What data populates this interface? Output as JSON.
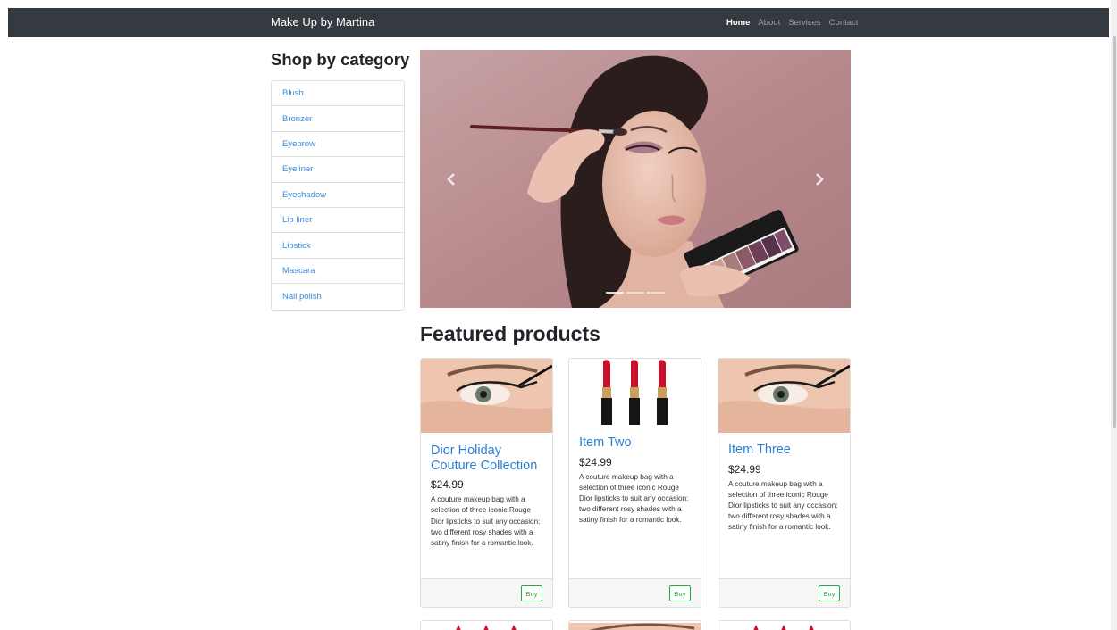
{
  "navbar": {
    "brand": "Make Up by Martina",
    "links": [
      "Home",
      "About",
      "Services",
      "Contact"
    ],
    "active_link": "Home"
  },
  "sidebar": {
    "title": "Shop by category",
    "categories": [
      "Blush",
      "Bronzer",
      "Eyebrow",
      "Eyeliner",
      "Eyeshadow",
      "Lip liner",
      "Lipstick",
      "Mascara",
      "Nail polish"
    ]
  },
  "carousel": {
    "prev_glyph": "‹",
    "next_glyph": "›",
    "slide_count": 3,
    "active_slide": 1
  },
  "featured": {
    "title": "Featured products",
    "products": [
      {
        "title": "Dior Holiday Couture Collection",
        "price": "$24.99",
        "description": "A couture makeup bag with a selection of three iconic Rouge Dior lipsticks to suit any occasion: two different rosy shades with a satiny finish for a romantic look.",
        "button": "Buy",
        "image": "eyeliner-photo"
      },
      {
        "title": "Item Two",
        "price": "$24.99",
        "description": "A couture makeup bag with a selection of three iconic Rouge Dior lipsticks to suit any occasion: two different rosy shades with a satiny finish for a romantic look.",
        "button": "Buy",
        "image": "lipsticks-photo"
      },
      {
        "title": "Item Three",
        "price": "$24.99",
        "description": "A couture makeup bag with a selection of three iconic Rouge Dior lipsticks to suit any occasion: two different rosy shades with a satiny finish for a romantic look.",
        "button": "Buy",
        "image": "eyeliner-photo"
      }
    ]
  },
  "colors": {
    "navbar": "#343a40",
    "link": "#2b7fd2",
    "buy": "#28a745"
  }
}
